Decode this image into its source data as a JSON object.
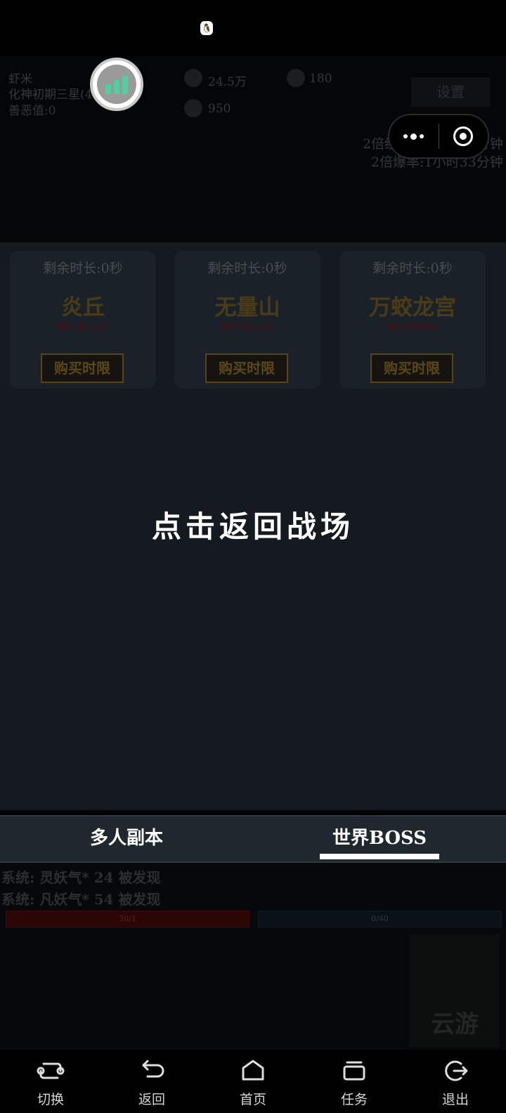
{
  "header": {
    "player_name": "虾米",
    "realm": "化神初期三星(4",
    "karma": "善恶值:0",
    "stat_a": "24.5万",
    "stat_b": "180",
    "stat_c": "950",
    "settings_label": "设置",
    "buff_1": "2倍经验:19小时51分钟",
    "buff_2": "2倍爆率:1小时33分钟"
  },
  "cards": [
    {
      "time": "剩余时长:0秒",
      "name": "炎丘",
      "sub": "需要1级以上队",
      "button": "购买时限"
    },
    {
      "time": "剩余时长:0秒",
      "name": "无量山",
      "sub": "需要1级以上队",
      "button": "购买时限"
    },
    {
      "time": "剩余时长:0秒",
      "name": "万蛟龙宫",
      "sub": "需要1级以上队",
      "button": "购买时限"
    }
  ],
  "return_label": "点击返回战场",
  "tabs": [
    {
      "label": "多人副本",
      "active": false
    },
    {
      "label": "世界BOSS",
      "active": true
    }
  ],
  "system": {
    "msg1": "系统: 灵妖气* 24  被发现",
    "msg2": "系统: 凡妖气* 54  被发现",
    "hp_value": "30/1",
    "mp_value": "0/40"
  },
  "logo_text": "云游",
  "nav": [
    {
      "label": "切换",
      "icon": "switch-icon"
    },
    {
      "label": "返回",
      "icon": "back-icon"
    },
    {
      "label": "首页",
      "icon": "home-icon"
    },
    {
      "label": "任务",
      "icon": "task-icon"
    },
    {
      "label": "退出",
      "icon": "exit-icon"
    }
  ],
  "colors": {
    "panel_bg": "#141a20",
    "tab_bg": "#1f282f",
    "signal_green": "#4ed1a0",
    "card_gold": "#5c4718"
  }
}
